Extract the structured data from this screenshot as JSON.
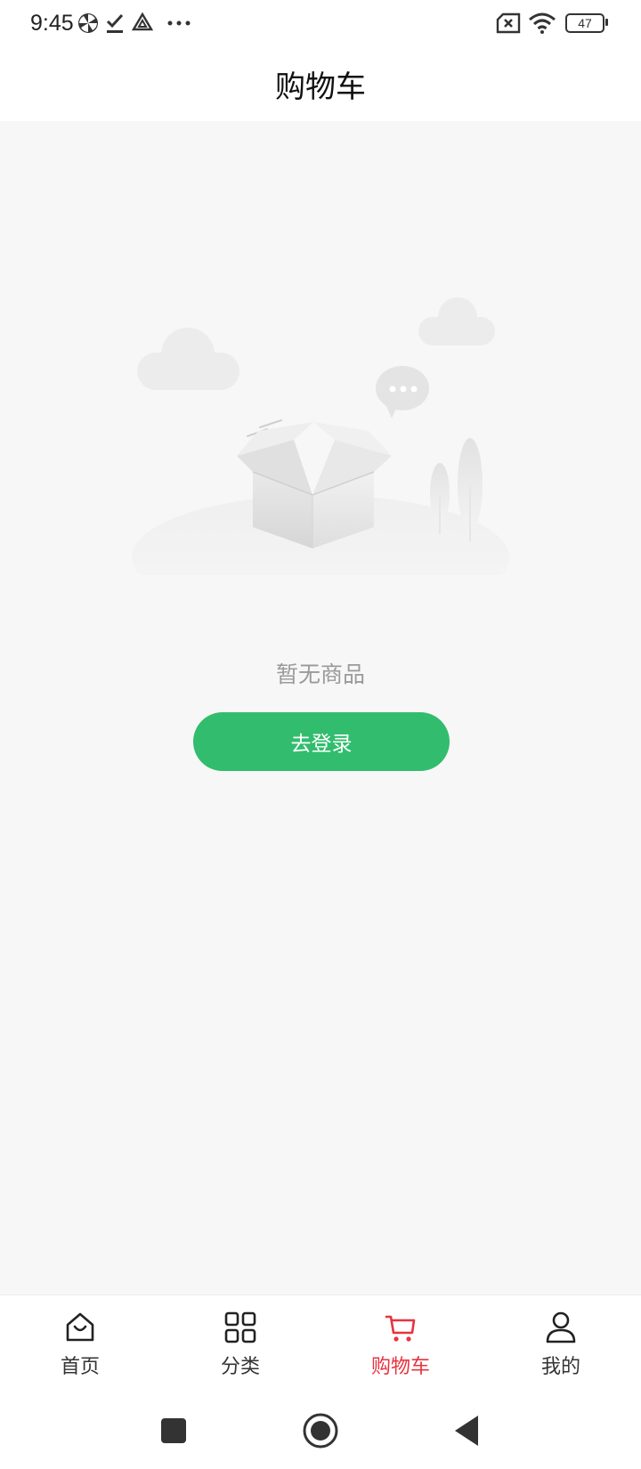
{
  "status_bar": {
    "time": "9:45",
    "battery": "47",
    "icons": [
      "pinwheel-icon",
      "download-done-icon",
      "drive-icon",
      "more-dots-icon",
      "sim-off-icon",
      "wifi-icon",
      "battery-icon"
    ]
  },
  "header": {
    "title": "购物车"
  },
  "empty_state": {
    "message": "暂无商品",
    "button_label": "去登录",
    "illustration": "empty-box-illustration"
  },
  "tab_bar": {
    "tabs": [
      {
        "label": "首页",
        "icon": "home-icon",
        "active": false
      },
      {
        "label": "分类",
        "icon": "grid-icon",
        "active": false
      },
      {
        "label": "购物车",
        "icon": "cart-icon",
        "active": true
      },
      {
        "label": "我的",
        "icon": "user-icon",
        "active": false
      }
    ]
  },
  "nav_bar": {
    "buttons": [
      "recents-button",
      "home-button",
      "back-button"
    ]
  },
  "colors": {
    "accent": "#31bd6d",
    "active_tab": "#e8333f",
    "background": "#f7f7f7",
    "muted_text": "#9a9a9a"
  }
}
